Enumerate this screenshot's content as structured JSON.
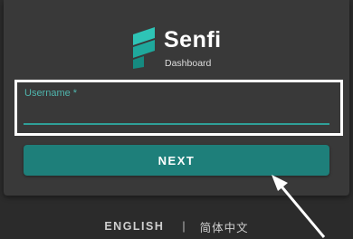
{
  "brand": {
    "name": "Senfi",
    "subtitle": "Dashboard",
    "logo_icon": "senfi-logo-icon",
    "accent_color": "#2ec4b6"
  },
  "login_form": {
    "username_label": "Username *",
    "username_value": "",
    "next_label": "NEXT",
    "button_color": "#1e7f7a"
  },
  "language": {
    "english_label": "ENGLISH",
    "separator": "|",
    "chinese_label": "简体中文"
  }
}
